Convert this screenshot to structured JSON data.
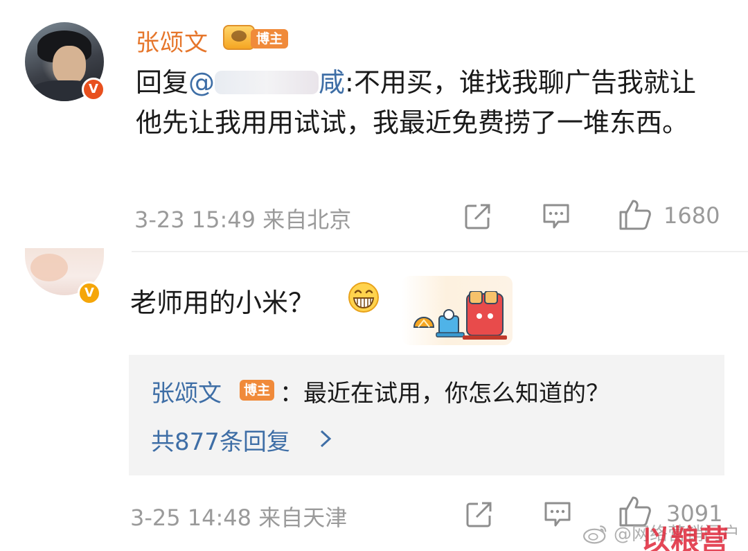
{
  "comments": [
    {
      "username": "张颂文",
      "badge": "博主",
      "reply_prefix": "回复",
      "mention_start": "@",
      "mention_end": "咸",
      "text": ":不用买，谁找我聊广告我就让他先让我用用试试，我最近免费捞了一堆东西。",
      "time": "3-23 15:49",
      "source": "来自北京",
      "likes": "1680",
      "verified_color": "#e8501e"
    },
    {
      "text": "老师用的小米？",
      "reply": {
        "username": "张颂文",
        "badge": "博主",
        "text": "：最近在试用，你怎么知道的？",
        "more": "共877条回复"
      },
      "time": "3-25 14:48",
      "source": "来自天津",
      "likes": "3091",
      "verified_color": "#f5a60a"
    }
  ],
  "watermark": {
    "weibo_text": "@网络营销门户",
    "logo_text": "以粮营"
  },
  "colors": {
    "username_orange": "#e6762b",
    "link_blue": "#3e6ea6",
    "badge_orange": "#f08a3a",
    "meta_gray": "#9a9a9a"
  }
}
